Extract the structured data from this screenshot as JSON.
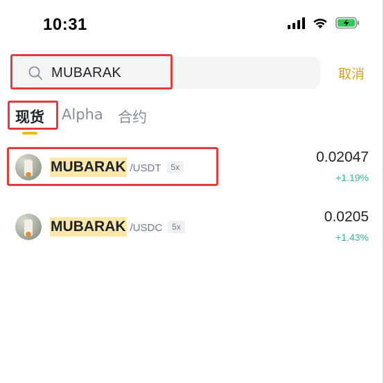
{
  "status_bar": {
    "time": "10:31",
    "icons": [
      "cellular-signal-icon",
      "wifi-icon",
      "battery-charging-icon"
    ]
  },
  "search": {
    "value": "MUBARAK",
    "icon": "search-icon",
    "cancel_label": "取消"
  },
  "tabs": [
    {
      "label": "现货",
      "active": true
    },
    {
      "label": "Alpha",
      "active": false
    },
    {
      "label": "合约",
      "active": false
    }
  ],
  "results": [
    {
      "base": "MUBARAK",
      "quote": "/USDT",
      "leverage": "5x",
      "price": "0.02047",
      "change": "+1.19%"
    },
    {
      "base": "MUBARAK",
      "quote": "/USDC",
      "leverage": "5x",
      "price": "0.0205",
      "change": "+1.43%"
    }
  ],
  "colors": {
    "accent": "#f0b90b",
    "cancel": "#d9a11a",
    "positive": "#2ebd85",
    "highlight": "#fbe7a9",
    "annotation_box": "#e03d3d"
  }
}
